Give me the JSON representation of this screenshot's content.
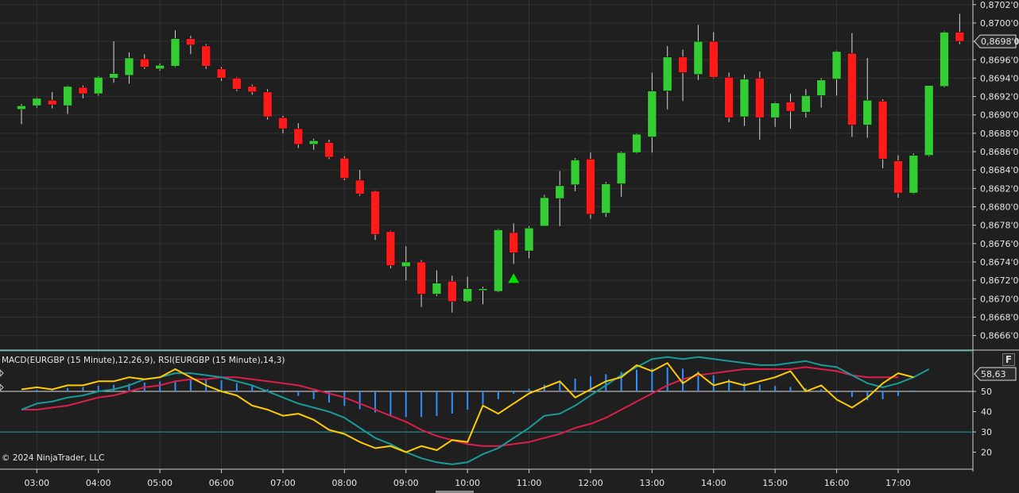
{
  "panel_titles": {
    "indicators": "MACD(EURGBP (15 Minute),12,26,9), RSI(EURGBP (15 Minute),14,3)"
  },
  "copyright": "© 2024 NinjaTrader, LLC",
  "f_button": "F",
  "colors": {
    "background": "#1f1f1f",
    "grid": "#323232",
    "up": "#33cc33",
    "down": "#ff1a1a",
    "wick": "#d8d8d8",
    "signal_arrow": "#00e000",
    "macd_hist": "#2f8fff",
    "macd_line": "#1a9a9a",
    "macd_signal": "#dc1f4a",
    "rsi_line": "#ffcc00",
    "rsi_bands": "#1aa0a0"
  },
  "chart_data": {
    "type": "candlestick",
    "symbol": "EURGBP",
    "timeframe": "15 Minute",
    "price_axis": {
      "ticks": [
        "0,8666'0",
        "0,8668'0",
        "0,8670'0",
        "0,8672'0",
        "0,8674'0",
        "0,8676'0",
        "0,8678'0",
        "0,8680'0",
        "0,8682'0",
        "0,8684'0",
        "0,8686'0",
        "0,8688'0",
        "0,8690'0",
        "0,8692'0",
        "0,8694'0",
        "0,8696'0",
        "0,8698'0",
        "0,8700'0",
        "0,8702'0"
      ],
      "ylim": [
        0.86645,
        0.87025
      ],
      "current_price_label": "0,8698'0",
      "current_price": 0.8698
    },
    "time_axis": {
      "ticks": [
        "03:00",
        "04:00",
        "05:00",
        "06:00",
        "07:00",
        "08:00",
        "09:00",
        "10:00",
        "11:00",
        "12:00",
        "13:00",
        "14:00",
        "15:00",
        "16:00",
        "17:00"
      ]
    },
    "candles": [
      {
        "t": "02:45",
        "o": 0.86906,
        "h": 0.86912,
        "l": 0.8689,
        "c": 0.8691
      },
      {
        "t": "03:00",
        "o": 0.8691,
        "h": 0.86919,
        "l": 0.86908,
        "c": 0.86918
      },
      {
        "t": "03:15",
        "o": 0.86916,
        "h": 0.86925,
        "l": 0.86907,
        "c": 0.86911
      },
      {
        "t": "03:30",
        "o": 0.8691,
        "h": 0.86932,
        "l": 0.86901,
        "c": 0.86931
      },
      {
        "t": "03:45",
        "o": 0.8693,
        "h": 0.86932,
        "l": 0.86918,
        "c": 0.86923
      },
      {
        "t": "04:00",
        "o": 0.86923,
        "h": 0.86942,
        "l": 0.86921,
        "c": 0.86941
      },
      {
        "t": "04:15",
        "o": 0.8694,
        "h": 0.8698,
        "l": 0.86935,
        "c": 0.86945
      },
      {
        "t": "04:30",
        "o": 0.86943,
        "h": 0.86968,
        "l": 0.86934,
        "c": 0.86962
      },
      {
        "t": "04:45",
        "o": 0.86961,
        "h": 0.86966,
        "l": 0.8695,
        "c": 0.86952
      },
      {
        "t": "05:00",
        "o": 0.8695,
        "h": 0.86956,
        "l": 0.86948,
        "c": 0.86954
      },
      {
        "t": "05:15",
        "o": 0.86953,
        "h": 0.86992,
        "l": 0.86952,
        "c": 0.86983
      },
      {
        "t": "05:30",
        "o": 0.86983,
        "h": 0.86986,
        "l": 0.86966,
        "c": 0.86976
      },
      {
        "t": "05:45",
        "o": 0.86975,
        "h": 0.86977,
        "l": 0.8695,
        "c": 0.86953
      },
      {
        "t": "06:00",
        "o": 0.8695,
        "h": 0.86952,
        "l": 0.86937,
        "c": 0.8694
      },
      {
        "t": "06:15",
        "o": 0.8694,
        "h": 0.86941,
        "l": 0.86926,
        "c": 0.86928
      },
      {
        "t": "06:30",
        "o": 0.86931,
        "h": 0.86933,
        "l": 0.86922,
        "c": 0.86925
      },
      {
        "t": "06:45",
        "o": 0.86925,
        "h": 0.86928,
        "l": 0.86895,
        "c": 0.86898
      },
      {
        "t": "07:00",
        "o": 0.86897,
        "h": 0.86899,
        "l": 0.8688,
        "c": 0.86885
      },
      {
        "t": "07:15",
        "o": 0.86885,
        "h": 0.86891,
        "l": 0.86864,
        "c": 0.86868
      },
      {
        "t": "07:30",
        "o": 0.86868,
        "h": 0.86874,
        "l": 0.86862,
        "c": 0.86872
      },
      {
        "t": "07:45",
        "o": 0.8687,
        "h": 0.86873,
        "l": 0.86852,
        "c": 0.86854
      },
      {
        "t": "08:00",
        "o": 0.86853,
        "h": 0.86855,
        "l": 0.86829,
        "c": 0.86831
      },
      {
        "t": "08:15",
        "o": 0.86829,
        "h": 0.8684,
        "l": 0.86812,
        "c": 0.86814
      },
      {
        "t": "08:30",
        "o": 0.86817,
        "h": 0.86818,
        "l": 0.86764,
        "c": 0.8677
      },
      {
        "t": "08:45",
        "o": 0.86773,
        "h": 0.86774,
        "l": 0.86733,
        "c": 0.86736
      },
      {
        "t": "09:00",
        "o": 0.86735,
        "h": 0.86757,
        "l": 0.8672,
        "c": 0.8674
      },
      {
        "t": "09:15",
        "o": 0.8674,
        "h": 0.86742,
        "l": 0.86691,
        "c": 0.86705
      },
      {
        "t": "09:30",
        "o": 0.86705,
        "h": 0.86731,
        "l": 0.86703,
        "c": 0.86717
      },
      {
        "t": "09:45",
        "o": 0.86719,
        "h": 0.86725,
        "l": 0.86685,
        "c": 0.86697
      },
      {
        "t": "10:00",
        "o": 0.86697,
        "h": 0.86724,
        "l": 0.86696,
        "c": 0.86711
      },
      {
        "t": "10:15",
        "o": 0.86709,
        "h": 0.86713,
        "l": 0.86694,
        "c": 0.86711
      },
      {
        "t": "10:30",
        "o": 0.86708,
        "h": 0.86776,
        "l": 0.86707,
        "c": 0.86775
      },
      {
        "t": "10:45",
        "o": 0.86772,
        "h": 0.86782,
        "l": 0.86738,
        "c": 0.8675
      },
      {
        "t": "11:00",
        "o": 0.86752,
        "h": 0.86779,
        "l": 0.86744,
        "c": 0.86777
      },
      {
        "t": "11:15",
        "o": 0.86779,
        "h": 0.86813,
        "l": 0.86779,
        "c": 0.8681
      },
      {
        "t": "11:30",
        "o": 0.86809,
        "h": 0.86839,
        "l": 0.86779,
        "c": 0.86823
      },
      {
        "t": "11:45",
        "o": 0.86824,
        "h": 0.86853,
        "l": 0.86817,
        "c": 0.86851
      },
      {
        "t": "12:00",
        "o": 0.86852,
        "h": 0.86859,
        "l": 0.86787,
        "c": 0.86792
      },
      {
        "t": "12:15",
        "o": 0.86793,
        "h": 0.86827,
        "l": 0.86789,
        "c": 0.86825
      },
      {
        "t": "12:30",
        "o": 0.86825,
        "h": 0.8686,
        "l": 0.86811,
        "c": 0.86859
      },
      {
        "t": "12:45",
        "o": 0.86859,
        "h": 0.8688,
        "l": 0.86858,
        "c": 0.86879
      },
      {
        "t": "13:00",
        "o": 0.86876,
        "h": 0.86946,
        "l": 0.86859,
        "c": 0.86926
      },
      {
        "t": "13:15",
        "o": 0.86926,
        "h": 0.86975,
        "l": 0.86906,
        "c": 0.86963
      },
      {
        "t": "13:30",
        "o": 0.86963,
        "h": 0.86971,
        "l": 0.86915,
        "c": 0.86946
      },
      {
        "t": "13:45",
        "o": 0.86944,
        "h": 0.86998,
        "l": 0.86938,
        "c": 0.8698
      },
      {
        "t": "14:00",
        "o": 0.8698,
        "h": 0.8699,
        "l": 0.8694,
        "c": 0.86941
      },
      {
        "t": "14:15",
        "o": 0.86941,
        "h": 0.86946,
        "l": 0.86892,
        "c": 0.86897
      },
      {
        "t": "14:30",
        "o": 0.86898,
        "h": 0.86944,
        "l": 0.86888,
        "c": 0.86939
      },
      {
        "t": "14:45",
        "o": 0.8694,
        "h": 0.86947,
        "l": 0.86873,
        "c": 0.86897
      },
      {
        "t": "15:00",
        "o": 0.86897,
        "h": 0.86914,
        "l": 0.86887,
        "c": 0.86913
      },
      {
        "t": "15:15",
        "o": 0.86914,
        "h": 0.86923,
        "l": 0.86885,
        "c": 0.86904
      },
      {
        "t": "15:30",
        "o": 0.86903,
        "h": 0.86928,
        "l": 0.86897,
        "c": 0.86921
      },
      {
        "t": "15:45",
        "o": 0.86921,
        "h": 0.8694,
        "l": 0.86908,
        "c": 0.86938
      },
      {
        "t": "16:00",
        "o": 0.86939,
        "h": 0.8697,
        "l": 0.86921,
        "c": 0.86969
      },
      {
        "t": "16:15",
        "o": 0.86967,
        "h": 0.86989,
        "l": 0.86876,
        "c": 0.86889
      },
      {
        "t": "16:30",
        "o": 0.86889,
        "h": 0.86962,
        "l": 0.86875,
        "c": 0.86916
      },
      {
        "t": "16:45",
        "o": 0.86915,
        "h": 0.86917,
        "l": 0.86842,
        "c": 0.86852
      },
      {
        "t": "17:00",
        "o": 0.8685,
        "h": 0.86856,
        "l": 0.8681,
        "c": 0.86815
      },
      {
        "t": "17:15",
        "o": 0.86815,
        "h": 0.86858,
        "l": 0.86814,
        "c": 0.86856
      },
      {
        "t": "17:30",
        "o": 0.86856,
        "h": 0.86907,
        "l": 0.86855,
        "c": 0.86932
      },
      {
        "t": "17:45",
        "o": 0.86931,
        "h": 0.86991,
        "l": 0.8693,
        "c": 0.8699
      },
      {
        "t": "18:00",
        "o": 0.8699,
        "h": 0.8701,
        "l": 0.86977,
        "c": 0.8698
      }
    ],
    "signals": [
      {
        "t": "10:45",
        "type": "buy-arrow"
      }
    ],
    "indicator_panel": {
      "rsi_axis_ticks": [
        "20",
        "30",
        "40",
        "50"
      ],
      "rsi_ylim": [
        12,
        70
      ],
      "rsi_bands": [
        30,
        70
      ],
      "rsi_current_label": "58,63",
      "rsi_current": 58.63,
      "rsi": [
        51,
        52,
        51,
        53,
        53,
        55,
        55,
        57,
        56,
        57,
        61,
        57,
        53,
        50,
        48,
        43,
        41,
        38,
        39,
        36,
        31,
        29,
        25,
        22,
        23,
        20,
        23,
        21,
        26,
        25,
        43,
        39,
        44,
        49,
        52,
        55,
        47,
        51,
        55,
        57,
        63,
        60,
        64,
        54,
        59,
        53,
        55,
        53,
        55,
        57,
        60,
        50,
        53,
        46,
        42,
        47,
        54,
        59,
        57
      ],
      "macd": [
        41,
        44,
        45,
        47,
        48,
        50,
        51,
        53,
        56,
        57,
        59,
        59,
        58,
        57,
        55,
        53,
        50,
        47,
        44,
        42,
        40,
        37,
        32,
        27,
        24,
        20,
        17,
        15,
        14,
        15,
        19,
        22,
        27,
        32,
        38,
        39,
        43,
        48,
        53,
        58,
        62,
        66,
        67,
        66,
        67,
        66,
        65,
        64,
        63,
        63,
        64,
        65,
        63,
        62,
        58,
        54,
        52,
        54,
        57,
        61
      ],
      "signal": [
        41,
        41,
        42,
        43,
        45,
        47,
        48,
        50,
        52,
        53,
        55,
        56,
        56,
        57,
        57,
        56,
        55,
        54,
        53,
        51,
        49,
        47,
        44,
        41,
        38,
        35,
        31,
        28,
        26,
        24,
        23,
        23,
        24,
        25,
        27,
        29,
        32,
        34,
        37,
        41,
        45,
        49,
        53,
        56,
        58,
        59,
        60,
        61,
        61,
        61,
        61,
        62,
        61,
        60,
        58,
        57,
        57,
        57
      ],
      "histogram": [
        0.3,
        0.5,
        0.6,
        0.8,
        1.0,
        1.2,
        1.4,
        1.6,
        1.8,
        2.0,
        2.2,
        2.3,
        2.0,
        1.5,
        1.0,
        0.4,
        -0.2,
        -0.8,
        -1.4,
        -2.0,
        -2.6,
        -3.2,
        -3.8,
        -4.3,
        -4.6,
        -4.6,
        -4.4,
        -4.0,
        -3.3,
        -2.4,
        -1.4,
        -0.4,
        0.5,
        1.2,
        1.9,
        2.3,
        2.7,
        3.1,
        3.5,
        3.9,
        4.1,
        4.3,
        4.1,
        3.6,
        2.9,
        2.2,
        1.6,
        1.2,
        1.0,
        0.8,
        0.6,
        0.4,
        -0.2,
        -1.0,
        -1.6,
        -1.4,
        -0.8,
        0.2
      ]
    }
  }
}
